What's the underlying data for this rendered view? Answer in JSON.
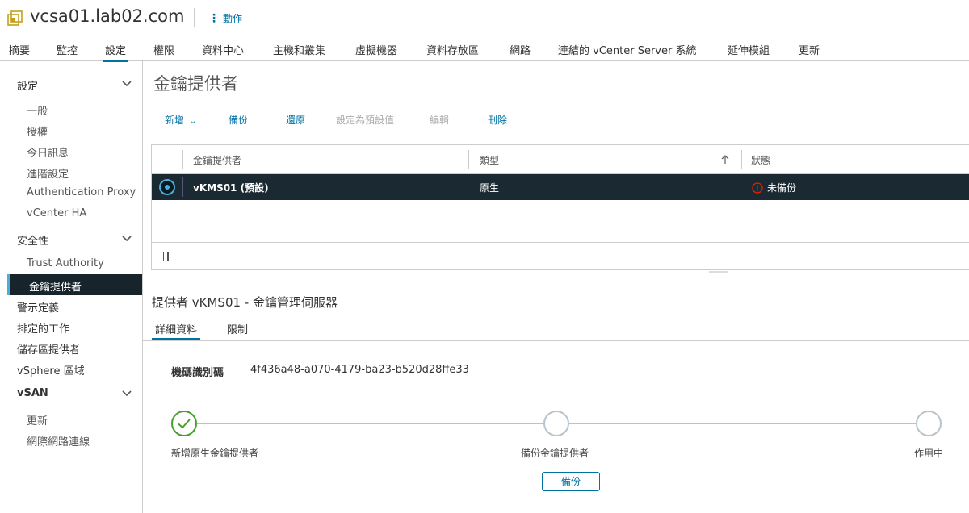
{
  "header": {
    "title": "vcsa01.lab02.com",
    "actions_label": "動作"
  },
  "nav": {
    "tabs": [
      "摘要",
      "監控",
      "設定",
      "權限",
      "資料中心",
      "主機和叢集",
      "虛擬機器",
      "資料存放區",
      "網路",
      "連結的 vCenter Server 系統",
      "延伸模組",
      "更新"
    ],
    "active": "設定"
  },
  "sidebar": {
    "sections": [
      {
        "label": "設定",
        "items": [
          "一般",
          "授權",
          "今日訊息",
          "進階設定",
          "Authentication Proxy",
          "vCenter HA"
        ]
      },
      {
        "label": "安全性",
        "items": [
          "Trust Authority",
          "金鑰提供者"
        ]
      }
    ],
    "active_item": "金鑰提供者",
    "top_items": [
      "警示定義",
      "排定的工作",
      "儲存區提供者",
      "vSphere 區域"
    ],
    "vsan": {
      "label": "vSAN",
      "items": [
        "更新",
        "網際網路連線"
      ]
    }
  },
  "main": {
    "title": "金鑰提供者",
    "toolbar": {
      "add": "新增",
      "backup": "備份",
      "restore": "還原",
      "set_default": "設定為預設值",
      "edit": "編輯",
      "delete": "刪除"
    },
    "grid": {
      "columns": [
        "金鑰提供者",
        "類型",
        "狀態"
      ],
      "rows": [
        {
          "name": "vKMS01 (預設)",
          "type": "原生",
          "status": "未備份"
        }
      ]
    },
    "detail": {
      "title": "提供者 vKMS01 - 金鑰管理伺服器",
      "tabs": [
        "詳細資料",
        "限制"
      ],
      "machine_id_label": "機碼識別碼",
      "machine_id_value": "4f436a48-a070-4179-ba23-b520d28ffe33",
      "steps": [
        "新增原生金鑰提供者",
        "備份金鑰提供者",
        "作用中"
      ],
      "backup_button": "備份"
    }
  },
  "colors": {
    "accent": "#0072a3",
    "selected_row": "#1b2a32",
    "warning": "#e12200",
    "success": "#489e2c"
  }
}
